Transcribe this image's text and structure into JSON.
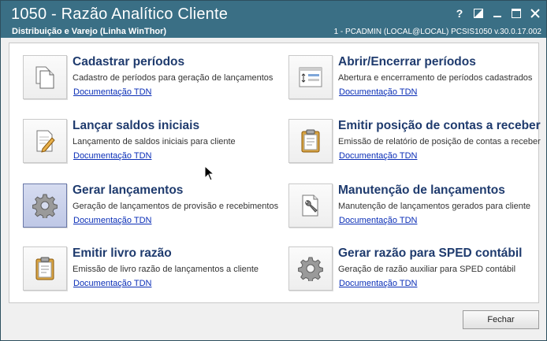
{
  "window": {
    "title": "1050 - Razão Analítico Cliente",
    "subtitle": "Distribuição e Varejo (Linha WinThor)",
    "info": "1 - PCADMIN (LOCAL@LOCAL)   PCSIS1050  v.30.0.17.002",
    "controls": [
      "help-icon",
      "restore-icon",
      "minimize-icon",
      "maximize-icon",
      "close-icon"
    ]
  },
  "cards": [
    {
      "title": "Cadastrar períodos",
      "desc": "Cadastro de períodos para geração de lançamentos",
      "link": "Documentação TDN",
      "icon": "documents-icon"
    },
    {
      "title": "Abrir/Encerrar períodos",
      "desc": "Abertura e encerramento de períodos cadastrados",
      "link": "Documentação TDN",
      "icon": "period-form-icon"
    },
    {
      "title": "Lançar saldos iniciais",
      "desc": "Lançamento de saldos iniciais para cliente",
      "link": "Documentação TDN",
      "icon": "edit-document-icon"
    },
    {
      "title": "Emitir posição de contas a receber",
      "desc": "Emissão de relatório de posição de contas a receber",
      "link": "Documentação TDN",
      "icon": "clipboard-icon"
    },
    {
      "title": "Gerar lançamentos",
      "desc": "Geração de lançamentos de provisão e recebimentos",
      "link": "Documentação TDN",
      "icon": "gear-icon"
    },
    {
      "title": "Manutenção de lançamentos",
      "desc": "Manutenção de lançamentos gerados para cliente",
      "link": "Documentação TDN",
      "icon": "wrench-document-icon"
    },
    {
      "title": "Emitir livro razão",
      "desc": "Emissão de livro razão de lançamentos a cliente",
      "link": "Documentação TDN",
      "icon": "clipboard-icon"
    },
    {
      "title": "Gerar razão para SPED contábil",
      "desc": "Geração de razão auxiliar para SPED contábil",
      "link": "Documentação TDN",
      "icon": "gear-icon"
    }
  ],
  "footer": {
    "close_label": "Fechar"
  },
  "colors": {
    "titlebar": "#3a6f85",
    "card_title": "#1f3b6e",
    "link": "#0b2fb7",
    "selected_icon": "#c6cfea"
  }
}
